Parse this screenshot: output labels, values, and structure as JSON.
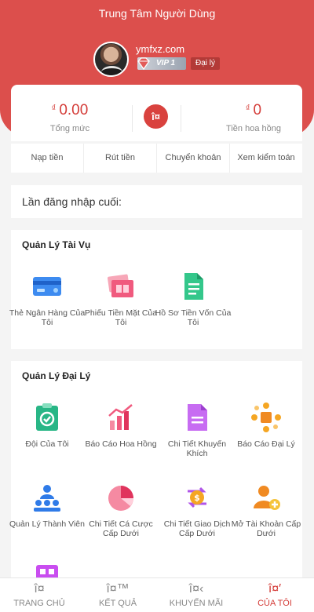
{
  "header": {
    "title": "Trung Tâm Người Dùng",
    "username": "ymfxz.com",
    "vip": "VIP 1",
    "role_badge": "Đại lý"
  },
  "wallet": {
    "currency": "₫",
    "total_value": "0.00",
    "total_label": "Tổng mức",
    "commission_value": "0",
    "commission_label": "Tiền hoa hồng",
    "refresh_icon": "refresh-icon",
    "refresh_glyph": "î¤"
  },
  "actions": [
    "Nạp tiền",
    "Rút tiền",
    "Chuyển khoản",
    "Xem kiểm toán"
  ],
  "last_login": "Lần đăng nhập cuối:",
  "finance": {
    "title": "Quản Lý Tài Vụ",
    "items": [
      {
        "label": "Thẻ Ngân Hàng Của Tôi",
        "icon": "bank-card-icon"
      },
      {
        "label": "Phiếu Tiền Mặt Của Tôi",
        "icon": "cash-voucher-icon"
      },
      {
        "label": "Hồ Sơ Tiền Vốn Của Tôi",
        "icon": "fund-record-icon"
      }
    ]
  },
  "agent": {
    "title": "Quản Lý Đại Lý",
    "items": [
      {
        "label": "Đội Của Tôi",
        "icon": "team-icon"
      },
      {
        "label": "Báo Cáo Hoa Hồng",
        "icon": "commission-report-icon"
      },
      {
        "label": "Chi Tiết Khuyến Khích",
        "icon": "bonus-detail-icon"
      },
      {
        "label": "Báo Cáo Đại Lý",
        "icon": "agent-report-icon"
      },
      {
        "label": "Quản Lý Thành Viên",
        "icon": "member-manage-icon"
      },
      {
        "label": "Chi Tiết Cá Cược Cấp Dưới",
        "icon": "sub-bet-detail-icon"
      },
      {
        "label": "Chi Tiết Giao Dịch Cấp Dưới",
        "icon": "sub-transaction-icon"
      },
      {
        "label": "Mở Tài Khoản Cấp Dưới",
        "icon": "open-sub-account-icon"
      }
    ]
  },
  "tabbar": [
    {
      "label": "TRANG CHỦ",
      "glyph": "î¤",
      "icon": "home-icon",
      "active": false
    },
    {
      "label": "KẾT QUẢ",
      "glyph": "î¤™",
      "icon": "results-icon",
      "active": false
    },
    {
      "label": "KHUYẾN MÃI",
      "glyph": "î¤‹",
      "icon": "promotion-icon",
      "active": false
    },
    {
      "label": "CỦA TÔI",
      "glyph": "î¤′",
      "icon": "profile-icon",
      "active": true
    }
  ],
  "colors": {
    "brand_red": "#dc4f4c",
    "amount_red": "#d43c38"
  }
}
